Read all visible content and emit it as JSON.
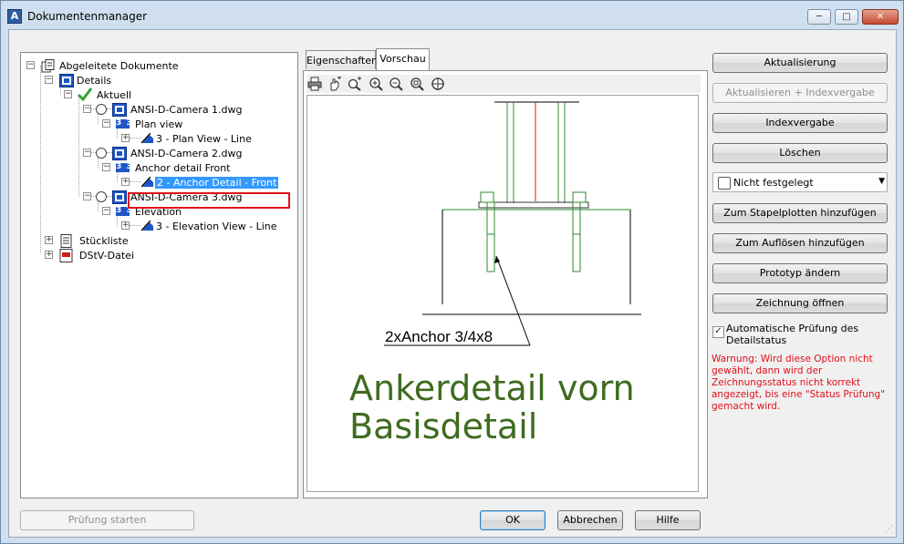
{
  "window": {
    "title": "Dokumentenmanager",
    "buttons": {
      "minimize": "─",
      "maximize": "□",
      "close": "✕"
    }
  },
  "tree": {
    "root": "Abgeleitete Dokumente",
    "details": "Details",
    "current": "Aktuell",
    "camera1": "ANSI-D-Camera 1.dwg",
    "plan_view": "Plan view",
    "plan_view_line": "3 - Plan View - Line",
    "camera2": "ANSI-D-Camera 2.dwg",
    "anchor_detail_front": "Anchor detail Front",
    "anchor_detail_front_item": "2 - Anchor Detail - Front",
    "camera3": "ANSI-D-Camera 3.dwg",
    "elevation": "Elevation",
    "elevation_view_line": "3 - Elevation View - Line",
    "stueckliste": "Stückliste",
    "dstv": "DStV-Datei",
    "sheet_icon_text": "3 3"
  },
  "tabs": {
    "properties": "Eigenschaften",
    "preview": "Vorschau"
  },
  "preview": {
    "anchor_label": "2xAnchor 3/4x8",
    "caption_line1": "Ankerdetail vorn",
    "caption_line2": "Basisdetail"
  },
  "actions": {
    "update": "Aktualisierung",
    "update_index": "Aktualisieren + Indexvergabe",
    "index": "Indexvergabe",
    "delete": "Löschen",
    "status_select": "Nicht festgelegt",
    "add_batch_plot": "Zum Stapelplotten hinzufügen",
    "add_resolve": "Zum Auflösen hinzufügen",
    "change_prototype": "Prototyp ändern",
    "open_drawing": "Zeichnung öffnen"
  },
  "auto_check": {
    "label": "Automatische Prüfung des Detailstatus",
    "checked": true,
    "warning": "Warnung: Wird diese Option nicht gewählt, dann wird der Zeichnungsstatus nicht korrekt angezeigt, bis eine \"Status Prüfung\" gemacht wird."
  },
  "footer": {
    "start_check": "Prüfung starten",
    "ok": "OK",
    "cancel": "Abbrechen",
    "help": "Hilfe"
  },
  "colors": {
    "window_frame": "#cfdfef",
    "selection": "#3399ff",
    "highlight_box": "#e0101a",
    "warning_text": "#e0101a",
    "caption_green": "#3f6b1f",
    "drawing_green": "#2e8b2e",
    "drawing_red": "#d11c1c"
  }
}
